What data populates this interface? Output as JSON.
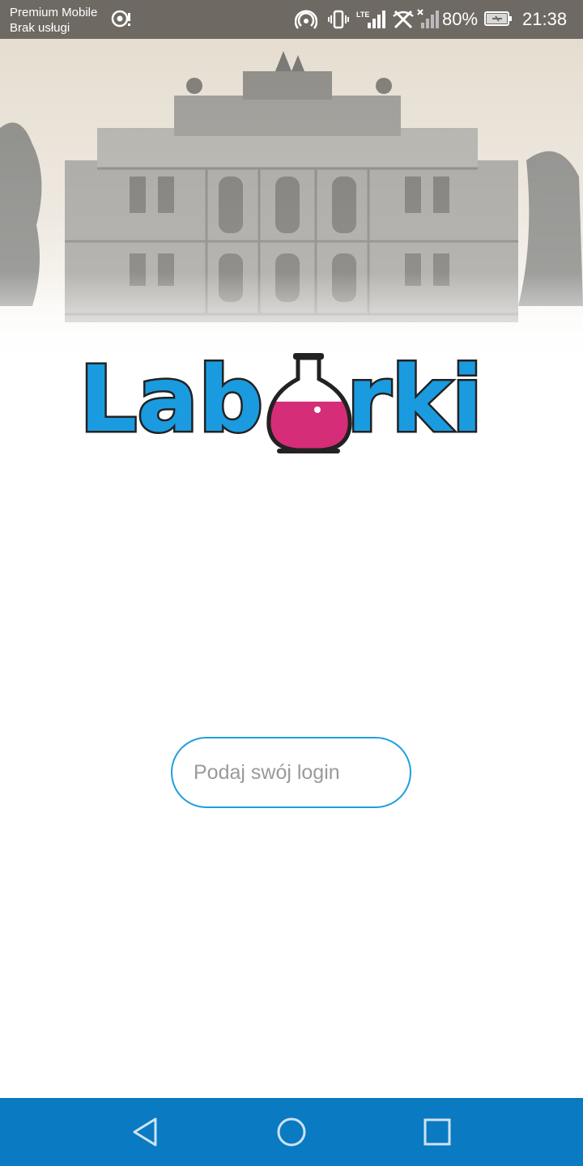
{
  "status_bar": {
    "carrier": "Premium Mobile",
    "carrier_status": "Brak usługi",
    "battery_percent": "80%",
    "time": "21:38",
    "icons": [
      "location-icon",
      "hotspot-icon",
      "vibrate-icon",
      "lte-signal-icon",
      "wifi-off-icon",
      "no-signal-icon",
      "battery-charging-icon"
    ]
  },
  "header": {
    "image": "old-theater-building-photo"
  },
  "logo": {
    "text": "Laborki",
    "colors": {
      "letters": "#1a9be0",
      "flask": "#d62d78",
      "outline": "#222222"
    }
  },
  "login": {
    "placeholder": "Podaj swój login",
    "value": ""
  },
  "nav_bar": {
    "color": "#0a7ac2",
    "buttons": [
      "back-icon",
      "home-icon",
      "recents-icon"
    ]
  }
}
